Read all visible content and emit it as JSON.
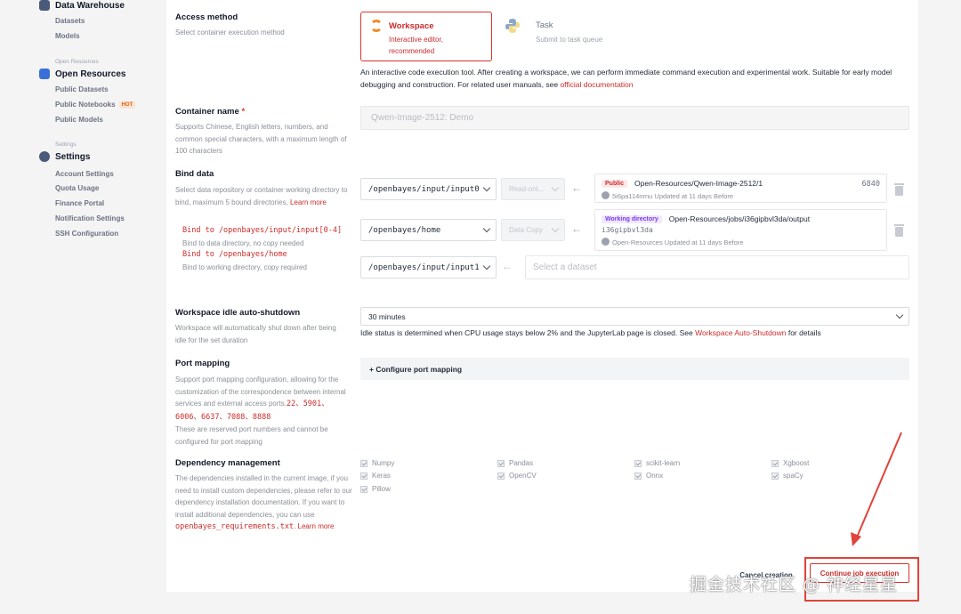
{
  "sidebar": {
    "data_warehouse": "Data Warehouse",
    "datasets": "Datasets",
    "models": "Models",
    "open_resources_small": "Open Resources",
    "open_resources": "Open Resources",
    "public_datasets": "Public Datasets",
    "public_notebooks": "Public Notebooks",
    "hot": "HOT",
    "public_models": "Public Models",
    "settings_small": "Settings",
    "settings": "Settings",
    "account_settings": "Account Settings",
    "quota_usage": "Quota Usage",
    "finance_portal": "Finance Portal",
    "notification_settings": "Notification Settings",
    "ssh_configuration": "SSH Configuration"
  },
  "access": {
    "label": "Access method",
    "desc": "Select container execution method",
    "workspace_title": "Workspace",
    "workspace_sub": "Interactive editor, recommended",
    "task_title": "Task",
    "task_sub": "Submit to task queue",
    "info_text": "An interactive code execution tool. After creating a workspace, we can perform immediate command execution and experimental work. Suitable for early model debugging and construction. For related user manuals, see ",
    "info_link": "official documentation"
  },
  "container": {
    "label": "Container name",
    "required": "*",
    "desc": "Supports Chinese, English letters, numbers, and common special characters, with a maximum length of 100 characters",
    "placeholder": "Qwen-Image-2512: Demo"
  },
  "bind": {
    "label": "Bind data",
    "desc": "Select data repository or container working directory to bind, maximum 5 bound directories, ",
    "learn_more": "Learn more",
    "hint1_code": "Bind to /openbayes/input/input[0-4]",
    "hint1_text": "Bind to data directory, no copy needed",
    "hint2_code": "Bind to /openbayes/home",
    "hint2_text": "Bind to working directory, copy required",
    "rows": [
      {
        "path": "/openbayes/input/input0",
        "mode": "Read-onl...",
        "tag": "Public",
        "name": "Open-Resources/Qwen-Image-2512/1",
        "size": "6840",
        "meta": "5i6pa114nrnu  Updated at 11 days Before"
      },
      {
        "path": "/openbayes/home",
        "mode": "Data Copy",
        "tag": "Working directory",
        "name": "Open-Resources/jobs/i36gipbvl3da/output",
        "id": "i36gipbvl3da",
        "meta": "Open-Resources Updated at 11 days Before"
      },
      {
        "path": "/openbayes/input/input1",
        "placeholder": "Select a dataset"
      }
    ]
  },
  "idle": {
    "label": "Workspace idle auto-shutdown",
    "desc": "Workspace will automatically shut down after being idle for the set duration",
    "value": "30 minutes",
    "note": "Idle status is determined when CPU usage stays below 2% and the JupyterLab page is closed. See ",
    "note_link": "Workspace Auto-Shutdown",
    "note_end": " for details"
  },
  "ports": {
    "label": "Port mapping",
    "desc": "Support port mapping configuration, allowing for the customization of the correspondence between internal services and external access ports.",
    "ports": "22、5901、6006、6637、7088、8888",
    "desc2": "These are reserved port numbers and cannot be configured for port mapping",
    "configure": "+ Configure port mapping"
  },
  "deps": {
    "label": "Dependency management",
    "desc": "The dependencies installed in the current image, if you need to install custom dependencies, please refer to our dependency installation documentation. If you want to install additional dependencies, you can use ",
    "file": "openbayes_requirements.txt",
    "learn_more": ". Learn more",
    "items": [
      "Numpy",
      "Pandas",
      "scikit-learn",
      "Xgboost",
      "Keras",
      "OpenCV",
      "Onnx",
      "spaCy",
      "Pillow"
    ]
  },
  "footer": {
    "cancel": "Cancel creation",
    "continue": "Continue job execution"
  },
  "watermark": "掘金技术社区 @ 神经星星",
  "colors": {
    "accent": "#cc2b2b",
    "annotation": "#e0433a"
  }
}
